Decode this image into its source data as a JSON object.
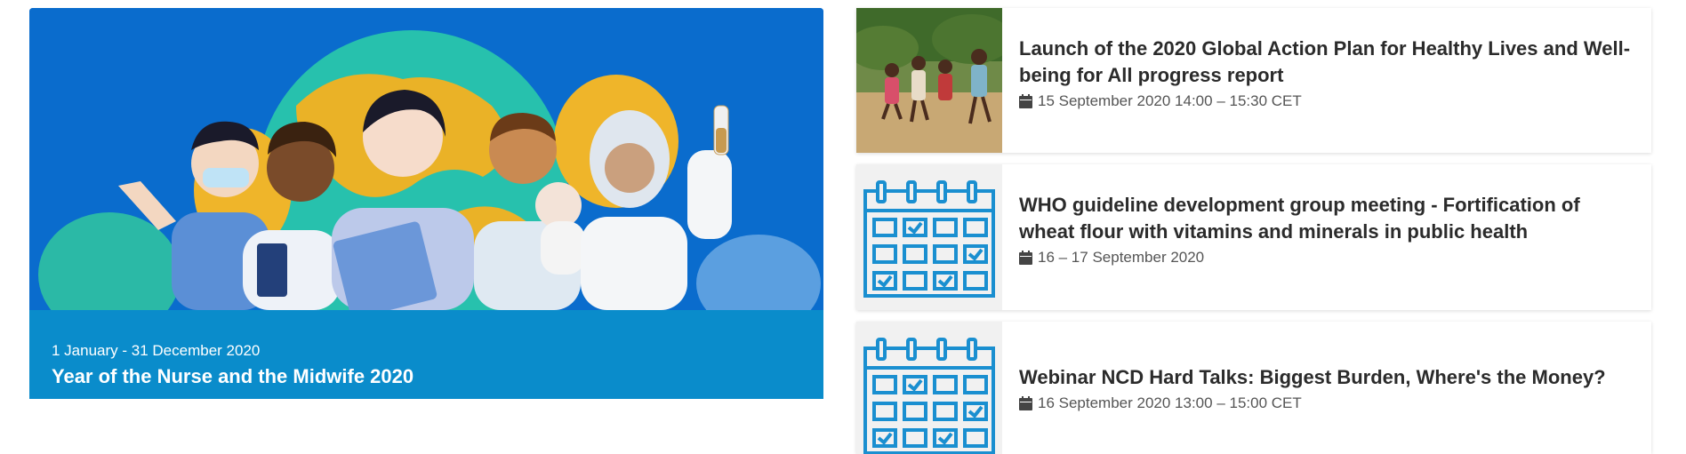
{
  "feature": {
    "date": "1 January - 31 December 2020",
    "title": "Year of the Nurse and the Midwife 2020"
  },
  "events": [
    {
      "title": "Launch of the 2020 Global Action Plan for Healthy Lives and Well-being for All progress report",
      "date": "15 September 2020 14:00 – 15:30 CET",
      "thumbnail": "photo-children-running"
    },
    {
      "title": "WHO guideline development group meeting - Fortification of wheat flour with vitamins and minerals in public health",
      "date": "16 – 17 September 2020",
      "thumbnail": "calendar-icon"
    },
    {
      "title": "Webinar NCD Hard Talks: Biggest Burden, Where's the Money?",
      "date": "16 September 2020 13:00 – 15:00 CET",
      "thumbnail": "calendar-icon"
    }
  ],
  "colors": {
    "feature_bg": "#0a6ccd",
    "caption_bg": "#0a8ccb",
    "calendar_blue": "#1a8fd0",
    "title_text": "#2b2b2b"
  }
}
